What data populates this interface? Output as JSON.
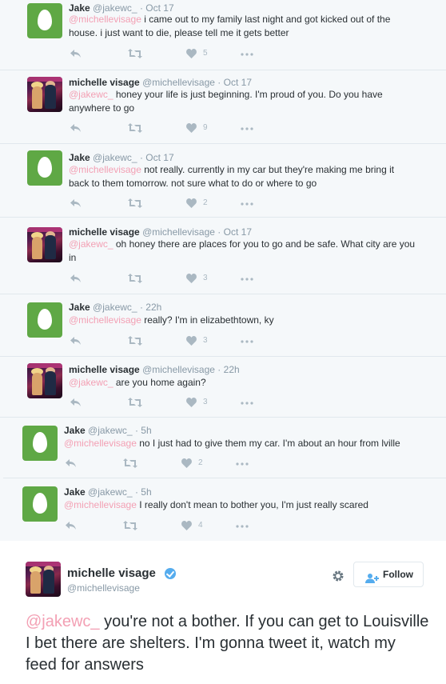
{
  "thread": [
    {
      "author": "Jake",
      "handle": "@jakewc_",
      "time": "Oct 17",
      "mention": "@michellevisage",
      "text": " i came out to my family last night and got kicked out of the house. i just want to die, please tell me it gets better",
      "likes": "5",
      "avatar": "egg-avatar"
    },
    {
      "author": "michelle visage",
      "handle": "@michellevisage",
      "time": "Oct 17",
      "mention": "@jakewc_",
      "text": " honey your life is just beginning. I'm proud of you. Do you have anywhere to go",
      "likes": "9",
      "avatar": "photo-avatar"
    },
    {
      "author": "Jake",
      "handle": "@jakewc_",
      "time": "Oct 17",
      "mention": "@michellevisage",
      "text": " not really. currently in my car but they're making me bring it back to them tomorrow. not sure what to do or where to go",
      "likes": "2",
      "avatar": "egg-avatar"
    },
    {
      "author": "michelle visage",
      "handle": "@michellevisage",
      "time": "Oct 17",
      "mention": "@jakewc_",
      "text": " oh honey there are places for you to go and be safe. What city are you in",
      "likes": "3",
      "avatar": "photo-avatar"
    },
    {
      "author": "Jake",
      "handle": "@jakewc_",
      "time": "22h",
      "mention": "@michellevisage",
      "text": " really? I'm in elizabethtown, ky",
      "likes": "3",
      "avatar": "egg-avatar"
    },
    {
      "author": "michelle visage",
      "handle": "@michellevisage",
      "time": "22h",
      "mention": "@jakewc_",
      "text": " are you home again?",
      "likes": "3",
      "avatar": "photo-avatar"
    },
    {
      "author": "Jake",
      "handle": "@jakewc_",
      "time": "5h",
      "mention": "@michellevisage",
      "text": " no I just had to give them my car. I'm about an hour from lville",
      "likes": "2",
      "avatar": "egg-avatar"
    },
    {
      "author": "Jake",
      "handle": "@jakewc_",
      "time": "5h",
      "mention": "@michellevisage",
      "text": " I really don't mean to bother you, I'm just really scared",
      "likes": "4",
      "avatar": "egg-avatar"
    }
  ],
  "main": {
    "author": "michelle visage",
    "handle": "@michellevisage",
    "follow_label": "Follow",
    "mention": "@jakewc_",
    "text": " you're not a bother. If you can get to Louisville I bet there are shelters. I'm gonna tweet it, watch my feed for answers"
  },
  "dot": "·"
}
